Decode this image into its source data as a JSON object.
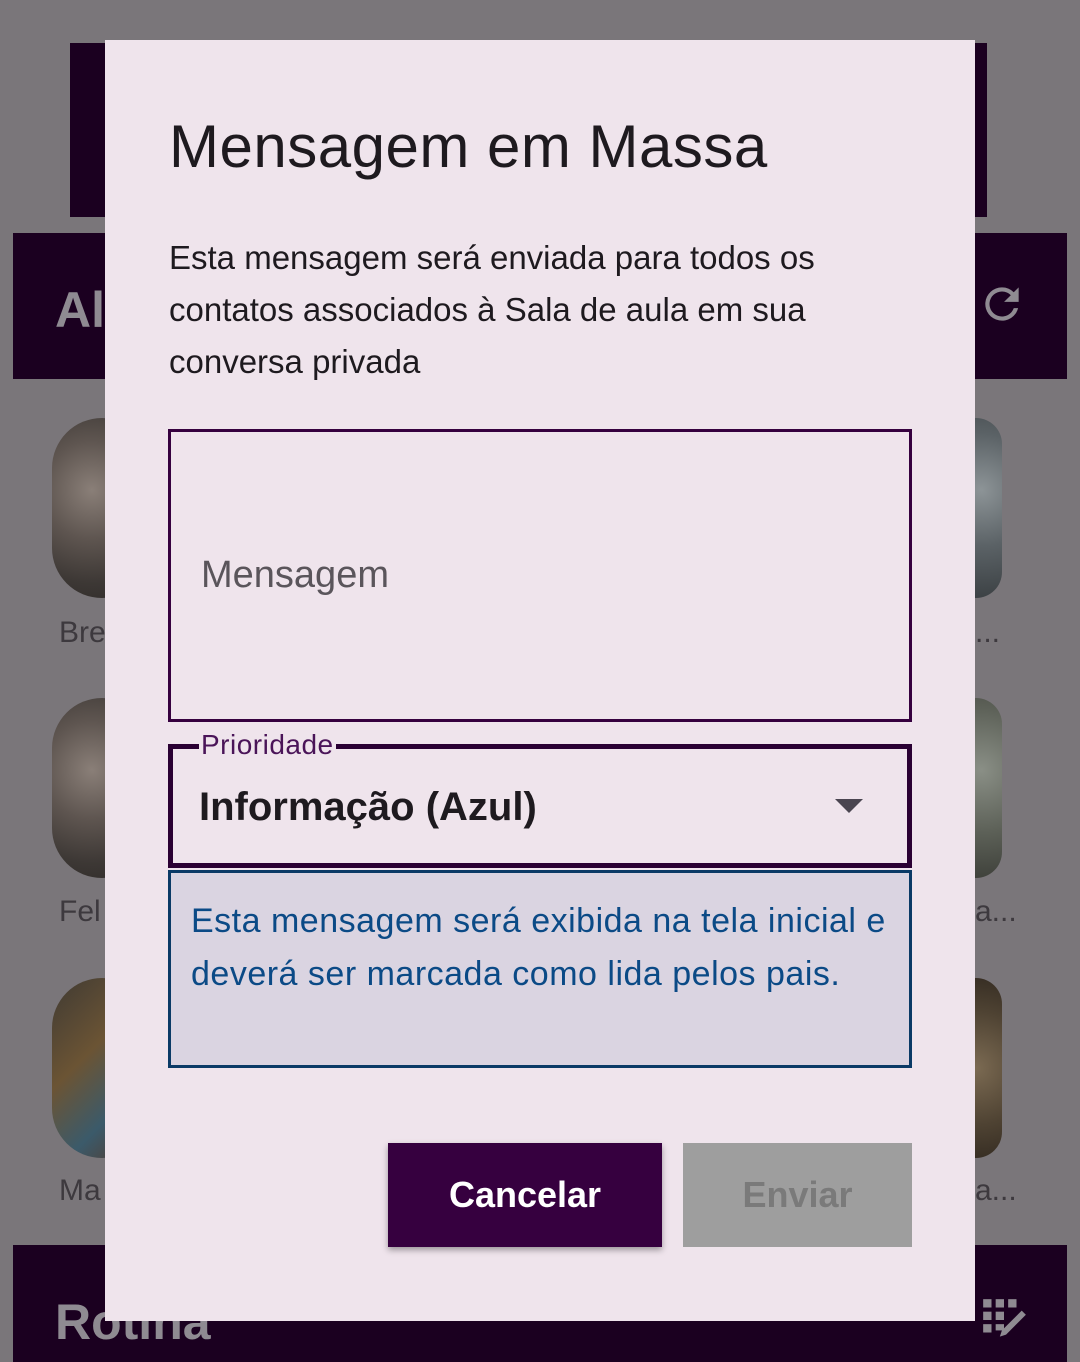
{
  "background": {
    "section_alunos_title": "Al",
    "section_rotina_title": "Rotina",
    "student_names_left": [
      "Bre",
      "Fel",
      "Ma"
    ],
    "student_names_right": [
      "...",
      "a...",
      "a..."
    ]
  },
  "dialog": {
    "title": "Mensagem em Massa",
    "description": "Esta mensagem será enviada para todos os contatos associados à Sala de aula em sua conversa privada",
    "message_placeholder": "Mensagem",
    "message_value": "",
    "priority": {
      "label": "Prioridade",
      "selected": "Informação (Azul)"
    },
    "info_text": "Esta mensagem será exibida na tela inicial e deverá ser marcada como lida pelos pais.",
    "cancel_label": "Cancelar",
    "send_label": "Enviar"
  },
  "colors": {
    "primary": "#36003f",
    "dialog_bg": "#efe4ec",
    "info_text": "#0b4a86",
    "disabled_button": "#9e9e9e"
  },
  "icons": [
    "refresh-icon",
    "edit-calendar-icon",
    "dropdown-arrow-icon"
  ]
}
